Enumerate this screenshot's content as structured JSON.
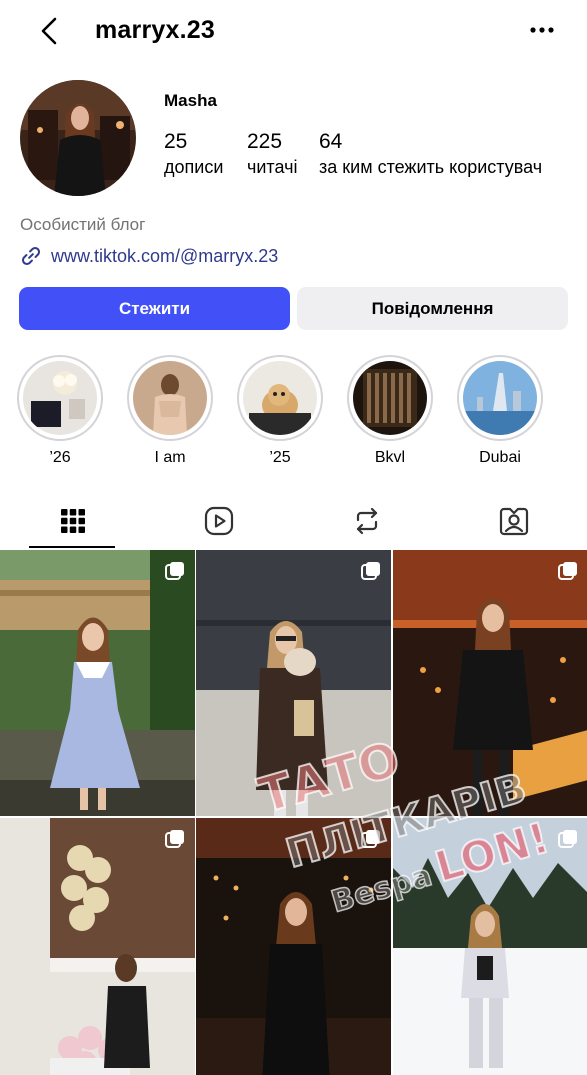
{
  "header": {
    "username": "marryx.23",
    "back_icon": "chevron-left-icon",
    "more_icon": "more-horizontal-icon"
  },
  "profile": {
    "name": "Masha",
    "stats": [
      {
        "value": "25",
        "label": "дописи"
      },
      {
        "value": "225",
        "label": "читачі"
      },
      {
        "value": "64",
        "label": "за ким стежить користувач"
      }
    ],
    "category": "Особистий блог",
    "link": "www.tiktok.com/@marryx.23"
  },
  "actions": {
    "follow_label": "Стежити",
    "message_label": "Повідомлення"
  },
  "highlights": [
    {
      "label": "’26"
    },
    {
      "label": "I am"
    },
    {
      "label": "’25"
    },
    {
      "label": "Bkvl"
    },
    {
      "label": "Dubai"
    }
  ],
  "tabs": [
    {
      "icon": "grid-icon",
      "active": true
    },
    {
      "icon": "reels-icon",
      "active": false
    },
    {
      "icon": "repost-icon",
      "active": false
    },
    {
      "icon": "tagged-icon",
      "active": false
    }
  ],
  "watermark": {
    "line1": "ТАТО",
    "line2": "ПЛІТКАРІВ",
    "line3": "Bespa",
    "line4": "LON!"
  },
  "colors": {
    "accent": "#4150f7",
    "link": "#2f3a8f",
    "secondary_text": "#737373"
  }
}
